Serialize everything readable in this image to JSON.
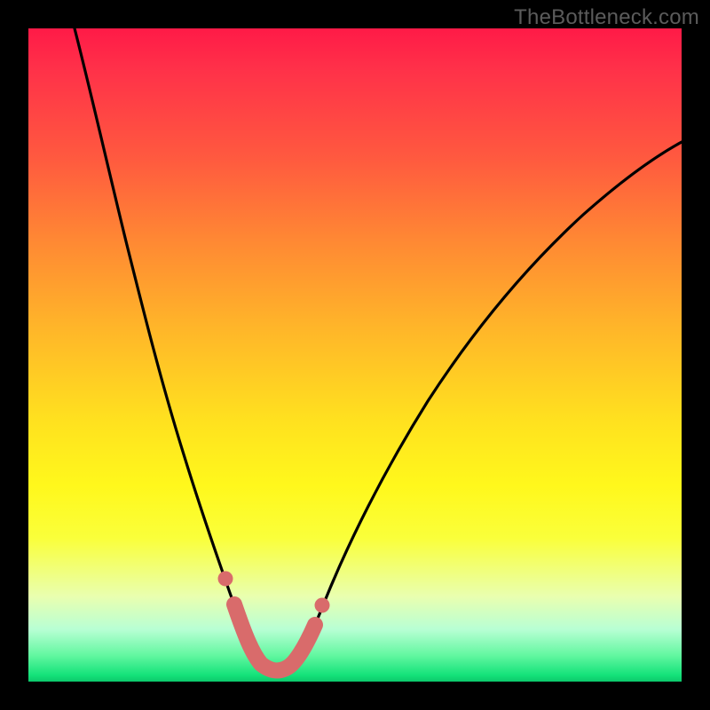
{
  "watermark": {
    "text": "TheBottleneck.com"
  },
  "chart_data": {
    "type": "line",
    "title": "",
    "xlabel": "",
    "ylabel": "",
    "xlim": [
      0,
      100
    ],
    "ylim": [
      0,
      100
    ],
    "grid": false,
    "legend": false,
    "series": [
      {
        "name": "bottleneck-curve",
        "color": "#000000",
        "x": [
          7,
          10,
          13,
          16,
          19,
          22,
          25,
          28,
          30,
          32,
          33.5,
          35,
          37,
          39,
          42,
          46,
          51,
          57,
          64,
          72,
          81,
          91,
          100
        ],
        "y": [
          100,
          88,
          76,
          65,
          54,
          44,
          34,
          25,
          18,
          12,
          8,
          4,
          2,
          2,
          4,
          10,
          18,
          28,
          38,
          49,
          59,
          68,
          75
        ]
      },
      {
        "name": "highlight-segment",
        "color": "#d96b6b",
        "style": "thick-dotted",
        "x": [
          30,
          32,
          33.5,
          35,
          37,
          39,
          42
        ],
        "y": [
          18,
          12,
          8,
          4,
          2,
          2,
          10
        ]
      }
    ],
    "annotations": []
  },
  "colors": {
    "frame": "#000000",
    "gradient_top": "#ff1a47",
    "gradient_bottom": "#0cc96b",
    "curve": "#000000",
    "highlight": "#d96b6b",
    "watermark": "#5b5b5b"
  }
}
